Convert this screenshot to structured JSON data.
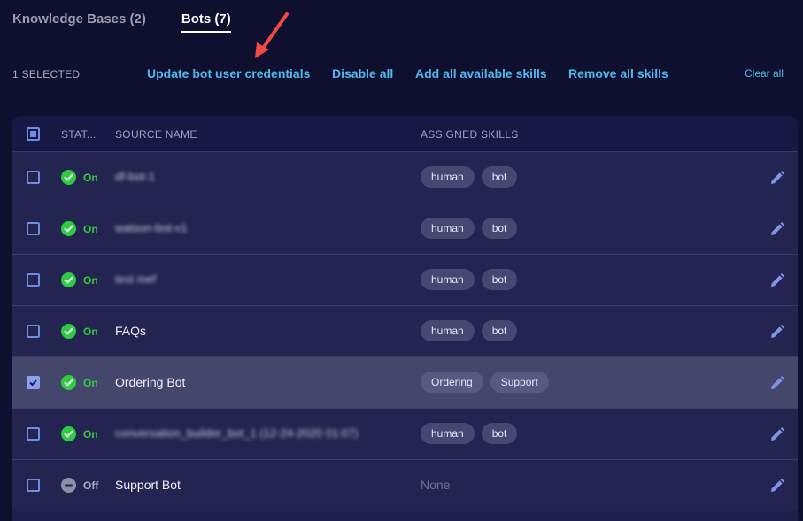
{
  "tabs": [
    {
      "label": "Knowledge Bases (2)",
      "active": false
    },
    {
      "label": "Bots (7)",
      "active": true
    }
  ],
  "actionbar": {
    "selected_count": "1 SELECTED",
    "actions": [
      "Update bot user credentials",
      "Disable all",
      "Add all available skills",
      "Remove all skills"
    ],
    "clear_label": "Clear all"
  },
  "table": {
    "header_checkbox": "indeterminate",
    "columns": [
      "STAT...",
      "SOURCE NAME",
      "ASSIGNED SKILLS"
    ],
    "rows": [
      {
        "checked": false,
        "status": "On",
        "status_state": "on",
        "name": "df-bot-1",
        "blurred": true,
        "skills": [
          "human",
          "bot"
        ],
        "no_skills_text": ""
      },
      {
        "checked": false,
        "status": "On",
        "status_state": "on",
        "name": "watson-bot-v1",
        "blurred": true,
        "skills": [
          "human",
          "bot"
        ],
        "no_skills_text": ""
      },
      {
        "checked": false,
        "status": "On",
        "status_state": "on",
        "name": "test mef",
        "blurred": true,
        "skills": [
          "human",
          "bot"
        ],
        "no_skills_text": ""
      },
      {
        "checked": false,
        "status": "On",
        "status_state": "on",
        "name": "FAQs",
        "blurred": false,
        "skills": [
          "human",
          "bot"
        ],
        "no_skills_text": ""
      },
      {
        "checked": true,
        "status": "On",
        "status_state": "on",
        "name": "Ordering Bot",
        "blurred": false,
        "skills": [
          "Ordering",
          "Support"
        ],
        "no_skills_text": ""
      },
      {
        "checked": false,
        "status": "On",
        "status_state": "on",
        "name": "conversation_builder_bot_1 (12-24-2020 01:07)",
        "blurred": true,
        "skills": [
          "human",
          "bot"
        ],
        "no_skills_text": ""
      },
      {
        "checked": false,
        "status": "Off",
        "status_state": "off",
        "name": "Support Bot",
        "blurred": false,
        "skills": [],
        "no_skills_text": "None"
      }
    ]
  },
  "colors": {
    "background": "#0f1030",
    "accent": "#4fb8ec",
    "status_on": "#2ecc40",
    "status_off": "#8d90a6",
    "annotation_arrow": "#ef4b3f",
    "edit_icon": "#7f93e8"
  },
  "icons": {
    "status_on": "check-circle-icon",
    "status_off": "minus-circle-icon",
    "edit": "pencil-icon",
    "annotation": "red-arrow-icon"
  }
}
